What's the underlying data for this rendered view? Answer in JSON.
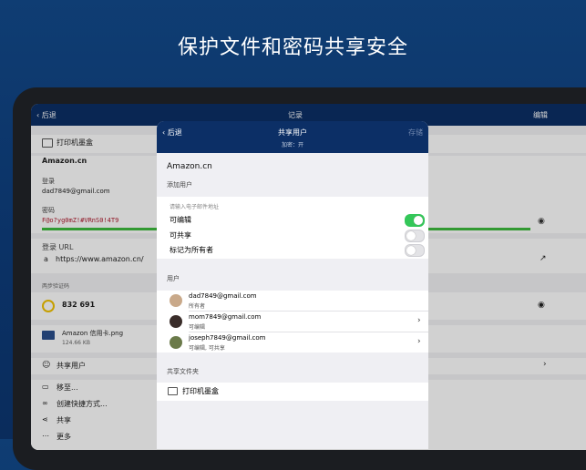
{
  "headline": "保护文件和密码共享安全",
  "topbar": {
    "back": "后退",
    "title": "记录",
    "edit": "编辑"
  },
  "record": {
    "folder": "打印机墨盒",
    "title": "Amazon.cn",
    "login_label": "登录",
    "login_value": "dad7849@gmail.com",
    "password_label": "密码",
    "password_value": "F@o?yg0mZ!#VRnS0!4T9",
    "url_label": "登录 URL",
    "url_value": "https://www.amazon.cn/",
    "totp_label": "两步验证码",
    "totp_value": "832 691",
    "file_name": "Amazon 信用卡.png",
    "file_size": "124.66 KB",
    "actions": [
      "共享用户",
      "移至...",
      "创建快捷方式...",
      "共享",
      "更多"
    ]
  },
  "modal": {
    "back": "后退",
    "title": "共享用户",
    "subtitle": "加密：开",
    "save": "存储",
    "record_title": "Amazon.cn",
    "add_user_heading": "添加用户",
    "email_placeholder": "请输入电子邮件地址",
    "options": [
      {
        "label": "可编辑",
        "on": true
      },
      {
        "label": "可共享",
        "on": false
      },
      {
        "label": "标记为所有者",
        "on": false
      }
    ],
    "users_heading": "用户",
    "users": [
      {
        "email": "dad7849@gmail.com",
        "role": "所有者"
      },
      {
        "email": "mom7849@gmail.com",
        "role": "可编辑"
      },
      {
        "email": "joseph7849@gmail.com",
        "role": "可编辑, 可共享"
      }
    ],
    "shared_folder_heading": "共享文件夹",
    "shared_folder": "打印机墨盒"
  },
  "colors": {
    "navy": "#0c2f66",
    "toggle_on": "#34c759",
    "strength_bar": "#3dbb3d",
    "totp_ring": "#f2c200"
  }
}
